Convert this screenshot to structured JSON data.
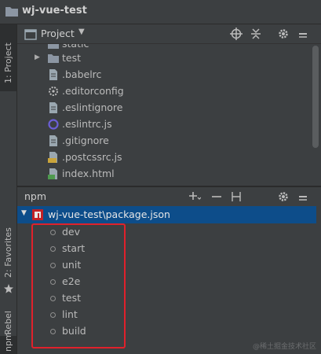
{
  "app": {
    "title": "wj-vue-test"
  },
  "side_tabs": {
    "project": "1: Project",
    "favorites": "2: Favorites",
    "jrebel": "JRebel",
    "npm": "npm"
  },
  "project_panel": {
    "title": "Project",
    "files": [
      {
        "name": "static",
        "type": "folder"
      },
      {
        "name": "test",
        "type": "folder"
      },
      {
        "name": ".babelrc",
        "type": "file"
      },
      {
        "name": ".editorconfig",
        "type": "config"
      },
      {
        "name": ".eslintignore",
        "type": "file"
      },
      {
        "name": ".eslintrc.js",
        "type": "eslint"
      },
      {
        "name": ".gitignore",
        "type": "file"
      },
      {
        "name": ".postcssrc.js",
        "type": "js"
      },
      {
        "name": "index.html",
        "type": "html"
      }
    ]
  },
  "npm_panel": {
    "title": "npm",
    "package": "wj-vue-test\\package.json",
    "scripts": [
      "dev",
      "start",
      "unit",
      "e2e",
      "test",
      "lint",
      "build"
    ]
  },
  "watermark": "@稀土掘金技术社区",
  "colors": {
    "selection": "#0d4d8a",
    "highlight_box": "#e0212b",
    "background": "#3c3f41"
  }
}
